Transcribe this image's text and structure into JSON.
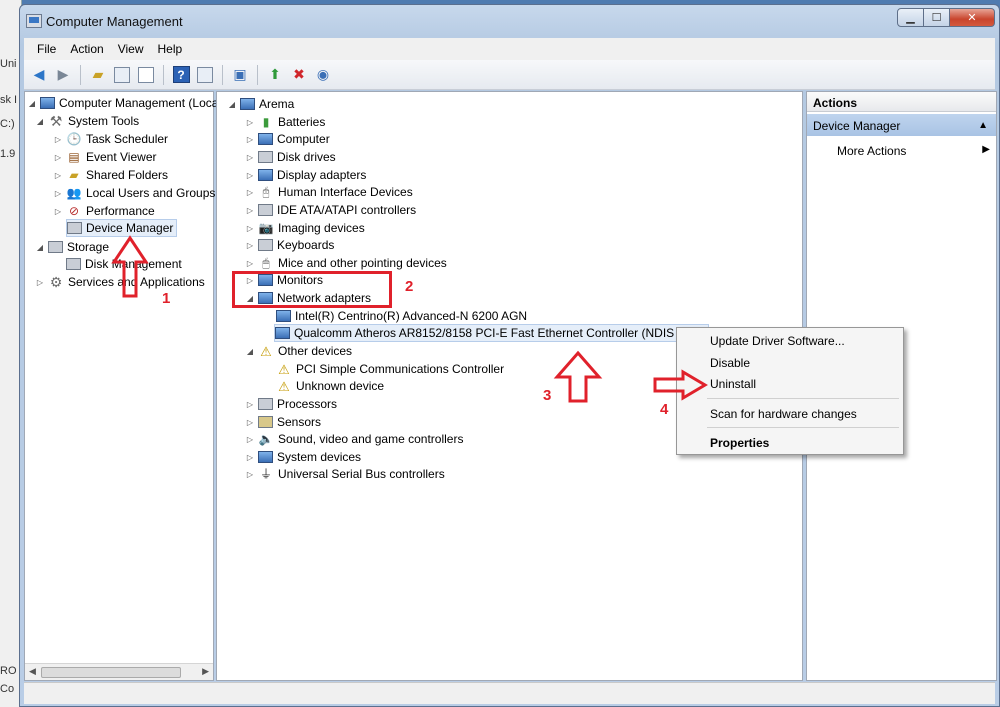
{
  "behind_window": [
    "Uni",
    "sk I",
    "C:)",
    "1.9",
    "RO",
    "Co"
  ],
  "window": {
    "title": "Computer Management"
  },
  "menubar": [
    "File",
    "Action",
    "View",
    "Help"
  ],
  "left_tree": {
    "root": "Computer Management (Local",
    "system_tools": "System Tools",
    "task_scheduler": "Task Scheduler",
    "event_viewer": "Event Viewer",
    "shared_folders": "Shared Folders",
    "local_users": "Local Users and Groups",
    "performance": "Performance",
    "device_manager": "Device Manager",
    "storage": "Storage",
    "disk_management": "Disk Management",
    "services": "Services and Applications"
  },
  "device_tree": {
    "root": "Arema",
    "categories": {
      "batteries": "Batteries",
      "computer": "Computer",
      "disk_drives": "Disk drives",
      "display_adapters": "Display adapters",
      "hid": "Human Interface Devices",
      "ide": "IDE ATA/ATAPI controllers",
      "imaging": "Imaging devices",
      "keyboards": "Keyboards",
      "mice": "Mice and other pointing devices",
      "monitors": "Monitors",
      "network_adapters": "Network adapters",
      "intel": "Intel(R) Centrino(R) Advanced-N 6200 AGN",
      "qualcomm": "Qualcomm Atheros AR8152/8158 PCI-E Fast Ethernet Controller (NDIS 6.20)",
      "other_devices": "Other devices",
      "pci": "PCI Simple Communications Controller",
      "unknown": "Unknown device",
      "processors": "Processors",
      "sensors": "Sensors",
      "sound": "Sound, video and game controllers",
      "system_devices": "System devices",
      "usb": "Universal Serial Bus controllers"
    }
  },
  "actions": {
    "header": "Actions",
    "section": "Device Manager",
    "more": "More Actions"
  },
  "context_menu": {
    "update": "Update Driver Software...",
    "disable": "Disable",
    "uninstall": "Uninstall",
    "scan": "Scan for hardware changes",
    "properties": "Properties"
  },
  "annotations": {
    "n1": "1",
    "n2": "2",
    "n3": "3",
    "n4": "4",
    "color": "#e0212b"
  }
}
